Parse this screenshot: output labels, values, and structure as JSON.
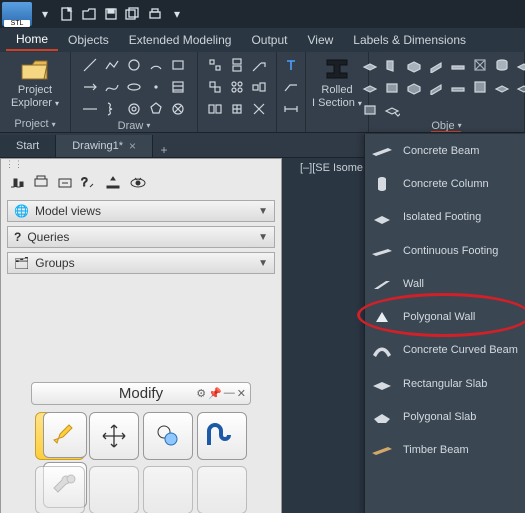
{
  "app": {
    "logo_badge": "STL"
  },
  "qat": {
    "dropdown": "▾"
  },
  "menus": [
    "Home",
    "Objects",
    "Extended Modeling",
    "Output",
    "View",
    "Labels & Dimensions"
  ],
  "active_menu": 0,
  "ribbon": {
    "project": {
      "big_label_1": "Project",
      "big_label_2": "Explorer",
      "panel": "Project",
      "arrow": "▾"
    },
    "draw": {
      "panel": "Draw",
      "arrow": "▾"
    },
    "rolled": {
      "label_1": "Rolled",
      "label_2": "I Section",
      "arrow": "▾"
    },
    "obj": {
      "panel": "Obje",
      "arrow": "▾"
    }
  },
  "tabs": {
    "start": "Start",
    "drawing": "Drawing1*",
    "close": "×",
    "new": "+"
  },
  "viewport_label": "[–][SE Isome",
  "palette": {
    "acc1": "Model views",
    "acc2": "Queries",
    "acc3": "Groups",
    "acc1_icon": "⬤",
    "acc2_icon": "?",
    "acc3_icon": "📁",
    "modify": "Modify"
  },
  "dropdown_items": [
    "Concrete  Beam",
    "Concrete  Column",
    "Isolated  Footing",
    "Continuous  Footing",
    "Wall",
    "Polygonal  Wall",
    "Concrete  Curved Beam",
    "Rectangular  Slab",
    "Polygonal  Slab",
    "Timber  Beam"
  ],
  "highlighted_index": 5
}
